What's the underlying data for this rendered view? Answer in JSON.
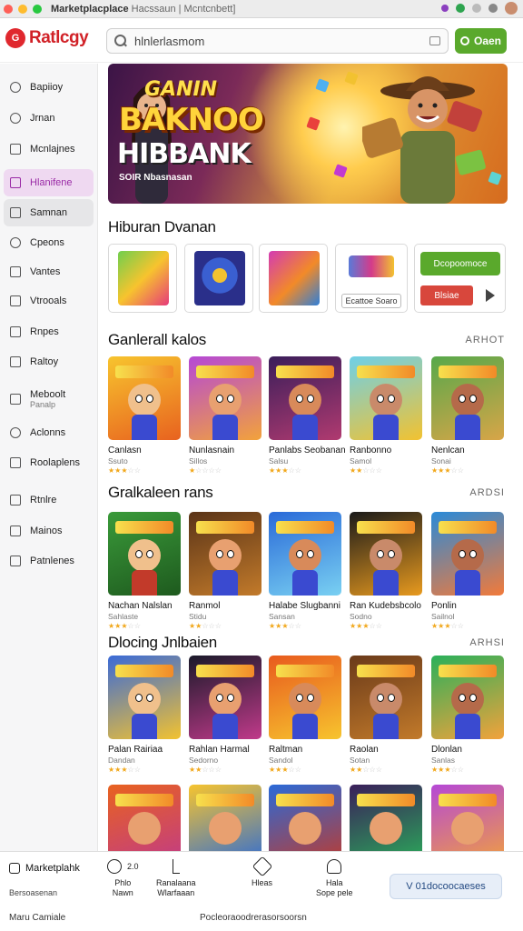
{
  "window": {
    "title": "Marketplacplace",
    "subtitle": "Hacssaun | Mcntcnbett]"
  },
  "header": {
    "brand": "Ratlcgy",
    "search_placeholder": "hlnlerlasmom",
    "open_label": "Oaen"
  },
  "sidebar": {
    "items": [
      {
        "label": "Bapiioy",
        "icon": "search-icon"
      },
      {
        "label": "Jrnan",
        "icon": "clock-icon"
      },
      {
        "label": "Mcnlajnes",
        "icon": "square-icon"
      },
      {
        "label": "Hlanifene",
        "icon": "controller-icon",
        "active": true
      },
      {
        "label": "Samnan",
        "icon": "monitor-icon",
        "hover": true
      },
      {
        "label": "Cpeons",
        "icon": "user-icon"
      },
      {
        "label": "Vantes",
        "icon": "chart-icon"
      },
      {
        "label": "Vtrooals",
        "icon": "upload-icon"
      },
      {
        "label": "Rnpes",
        "icon": "edit-icon"
      },
      {
        "label": "Raltoy",
        "icon": "document-icon"
      },
      {
        "label": "Meboolt",
        "sub": "Panalp",
        "icon": "grid-icon"
      },
      {
        "label": "Aclonns",
        "icon": "gear-icon"
      },
      {
        "label": "Roolaplens",
        "icon": "terminal-icon"
      },
      {
        "label": "Rtnlre",
        "icon": "image-icon"
      },
      {
        "label": "Mainos",
        "icon": "chart-bars-icon"
      },
      {
        "label": "Patnlenes",
        "icon": "settings-icon"
      }
    ]
  },
  "hero": {
    "line1": "GANIN",
    "line2": "BAKNOO",
    "line3": "HIBBANK",
    "sub": "SOIR Nbasnasan"
  },
  "categories": {
    "title": "Hiburan Dvanan",
    "cards": [
      {
        "label": ""
      },
      {
        "label": ""
      },
      {
        "label": ""
      },
      {
        "label": "Ecattoe Soaro"
      },
      {
        "btn1": "Dcopoomoce",
        "btn2": "Blsiae"
      }
    ]
  },
  "sections": [
    {
      "title": "Ganlerall kalos",
      "more": "ARHOT",
      "games": [
        {
          "name": "Canlasn",
          "sub": "Ssuto",
          "stars": "★★★",
          "dim": "☆☆"
        },
        {
          "name": "Nunlasnain",
          "sub": "Sillos",
          "stars": "★",
          "dim": "☆☆☆☆"
        },
        {
          "name": "Panlabs Seobanan",
          "sub": "Salsu",
          "stars": "★★★",
          "dim": "☆☆"
        },
        {
          "name": "Ranbonno",
          "sub": "Samol",
          "stars": "★★",
          "dim": "☆☆☆"
        },
        {
          "name": "Nenlcan",
          "sub": "Sonai",
          "stars": "★★★",
          "dim": "☆☆"
        }
      ]
    },
    {
      "title": "Gralkaleen rans",
      "more": "ARDSI",
      "games": [
        {
          "name": "Nachan Nalslan",
          "sub": "Sahlaste",
          "stars": "★★★",
          "dim": "☆☆"
        },
        {
          "name": "Ranmol",
          "sub": "Stidu",
          "stars": "★★",
          "dim": "☆☆☆"
        },
        {
          "name": "Halabe Slugbanni",
          "sub": "Sansan",
          "stars": "★★★",
          "dim": "☆☆"
        },
        {
          "name": "Ran Kudebsbcolo",
          "sub": "Sodno",
          "stars": "★★★",
          "dim": "☆☆"
        },
        {
          "name": "Ponlin",
          "sub": "Sailnol",
          "stars": "★★★",
          "dim": "☆☆"
        }
      ]
    },
    {
      "title": "Dlocing Jnlbaien",
      "more": "ARHSI",
      "games": [
        {
          "name": "Palan Rairiaa",
          "sub": "Dandan",
          "stars": "★★★",
          "dim": "☆☆"
        },
        {
          "name": "Rahlan Harmal",
          "sub": "Sedorno",
          "stars": "★★",
          "dim": "☆☆☆"
        },
        {
          "name": "Raltman",
          "sub": "Sandol",
          "stars": "★★★",
          "dim": "☆☆"
        },
        {
          "name": "Raolan",
          "sub": "Sotan",
          "stars": "★★",
          "dim": "☆☆☆"
        },
        {
          "name": "Dlonlan",
          "sub": "Sanlas",
          "stars": "★★★",
          "dim": "☆☆"
        }
      ]
    }
  ],
  "dock": {
    "brand": "Marketplahk",
    "brand_sub": "Bersoasenan",
    "items": [
      {
        "label": "Phlo\nNawn",
        "value": "2.0"
      },
      {
        "label": "Ranalaana\nWlarfaaan"
      },
      {
        "label": "Hleas"
      },
      {
        "label": "Hala\nSope pele"
      }
    ],
    "cta": "V 01docoocaeses",
    "footer_left": "Maru Camiale",
    "footer_mid": "Pocleoraoodrerasorsoorsn"
  },
  "colors": {
    "accent_green": "#5aa92c",
    "brand_red": "#d12127",
    "active_purple": "#9a2aa6"
  }
}
